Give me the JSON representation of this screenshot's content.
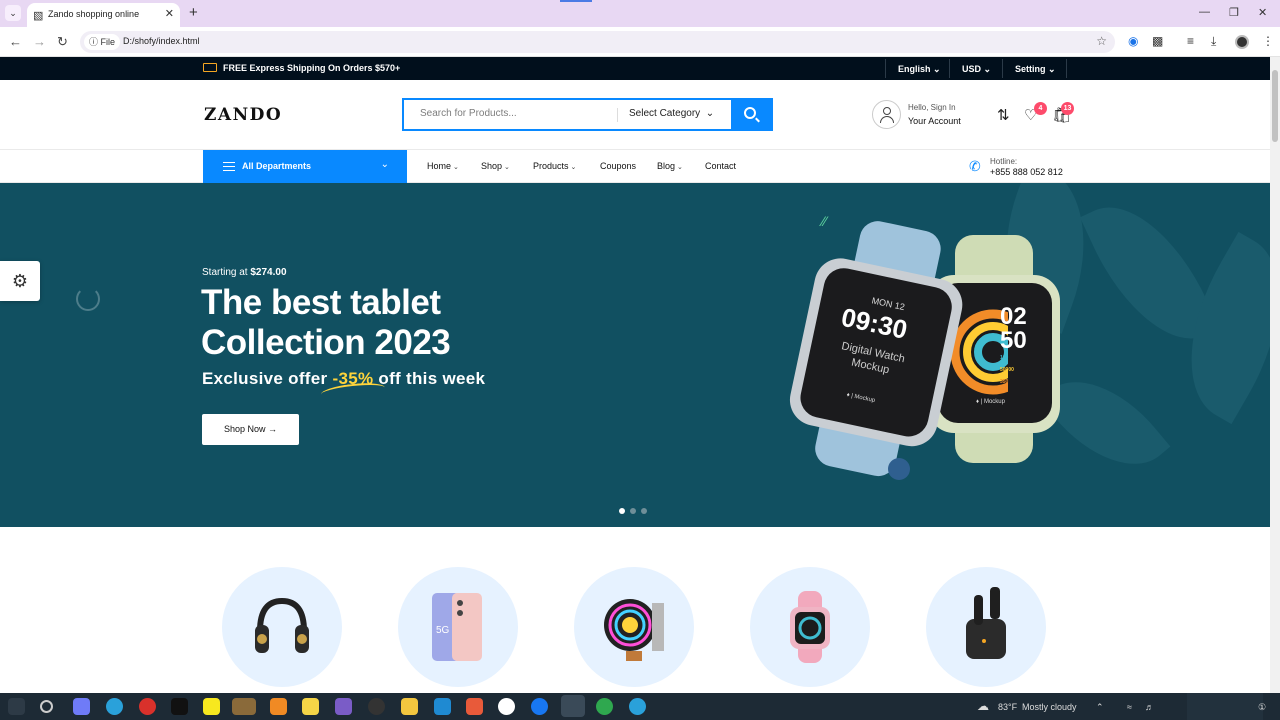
{
  "browser": {
    "tab_title": "Zando shopping online",
    "file_chip": "File",
    "url": "D:/shofy/index.html"
  },
  "topbar": {
    "shipping_text": "FREE Express Shipping On Orders $570+",
    "language": "English",
    "currency": "USD",
    "setting": "Setting"
  },
  "header": {
    "logo": "ZANDO",
    "search_placeholder": "Search for Products...",
    "category_select": "Select Category",
    "account_greeting": "Hello, Sign In",
    "account_label": "Your Account",
    "wishlist_count": "4",
    "cart_count": "13"
  },
  "nav": {
    "all_departments": "All Departments",
    "items": [
      {
        "label": "Home",
        "has_dropdown": true
      },
      {
        "label": "Shop",
        "has_dropdown": true
      },
      {
        "label": "Products",
        "has_dropdown": true
      },
      {
        "label": "Coupons",
        "has_dropdown": false
      },
      {
        "label": "Blog",
        "has_dropdown": true
      },
      {
        "label": "Contact",
        "has_dropdown": false
      }
    ],
    "hotline_label": "Hotline:",
    "hotline_number": "+855 888 052 812"
  },
  "hero": {
    "starting_prefix": "Starting at",
    "starting_price": "$274.00",
    "headline_line1": "The best tablet",
    "headline_line2": "Collection 2023",
    "offer_prefix": "Exclusive offer",
    "offer_discount": "-35%",
    "offer_suffix": "off this week",
    "cta": "Shop Now",
    "slides_total": 3,
    "slide_active": 1,
    "background_color": "#115061",
    "watch1": {
      "date": "MON 12",
      "time": "09:30",
      "caption1": "Digital Watch",
      "caption2": "Mockup",
      "mark": "Mockup"
    },
    "watch2": {
      "hour": "02",
      "minute": "50",
      "stats": [
        "100",
        "50000",
        "350"
      ],
      "mark": "Mockup"
    }
  },
  "categories": [
    {
      "icon": "headphones-icon"
    },
    {
      "icon": "smartphone-icon"
    },
    {
      "icon": "cpu-cooler-icon"
    },
    {
      "icon": "smartwatch-icon"
    },
    {
      "icon": "earbuds-icon"
    }
  ],
  "taskbar": {
    "weather_temp": "83°F",
    "weather_desc": "Mostly cloudy"
  },
  "colors": {
    "accent": "#0989ff",
    "topbar": "#010f1c",
    "badge": "#fd4b6b",
    "highlight": "#ffd43b"
  }
}
